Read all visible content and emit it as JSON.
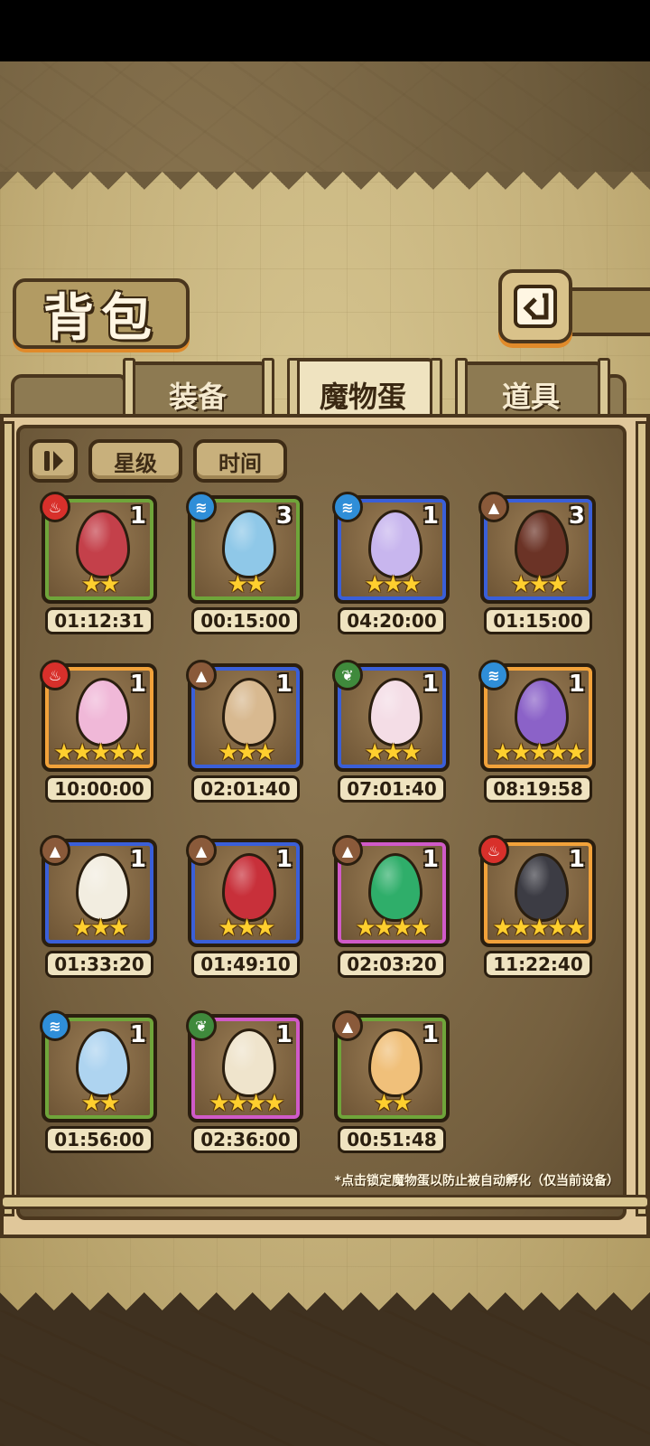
{
  "title": "背包",
  "tabs": [
    {
      "label": "装备",
      "active": false
    },
    {
      "label": "魔物蛋",
      "active": true
    },
    {
      "label": "道具",
      "active": false
    }
  ],
  "filters": {
    "toggle_icon": "pause-toggle-icon",
    "star": "星级",
    "time": "时间"
  },
  "footnote": "*点击锁定魔物蛋以防止被自动孵化（仅当前设备）",
  "element_colors": {
    "fire": "#d8302b",
    "water": "#2f8ed8",
    "earth": "#8a5a3a",
    "wood": "#3f8a3c"
  },
  "rarity_colors": {
    "green": "#6fa53a",
    "blue": "#3a5fd8",
    "gold": "#f2a23a",
    "purple": "#d05ac8"
  },
  "eggs": [
    {
      "element": "fire",
      "count": "1",
      "stars": 2,
      "rarity": "green",
      "timer": "01:12:31",
      "color": "#c4404a"
    },
    {
      "element": "water",
      "count": "3",
      "stars": 2,
      "rarity": "green",
      "timer": "00:15:00",
      "color": "#8fc8e8"
    },
    {
      "element": "water",
      "count": "1",
      "stars": 3,
      "rarity": "blue",
      "timer": "04:20:00",
      "color": "#c8b6ee"
    },
    {
      "element": "earth",
      "count": "3",
      "stars": 3,
      "rarity": "blue",
      "timer": "01:15:00",
      "color": "#6b3326"
    },
    {
      "element": "fire",
      "count": "1",
      "stars": 5,
      "rarity": "gold",
      "timer": "10:00:00",
      "color": "#f0b8d8"
    },
    {
      "element": "earth",
      "count": "1",
      "stars": 3,
      "rarity": "blue",
      "timer": "02:01:40",
      "color": "#d8b990"
    },
    {
      "element": "wood",
      "count": "1",
      "stars": 3,
      "rarity": "blue",
      "timer": "07:01:40",
      "color": "#f4dde6"
    },
    {
      "element": "water",
      "count": "1",
      "stars": 5,
      "rarity": "gold",
      "timer": "08:19:58",
      "color": "#8b62c8"
    },
    {
      "element": "earth",
      "count": "1",
      "stars": 3,
      "rarity": "blue",
      "timer": "01:33:20",
      "color": "#f2ede0"
    },
    {
      "element": "earth",
      "count": "1",
      "stars": 3,
      "rarity": "blue",
      "timer": "01:49:10",
      "color": "#c8303a"
    },
    {
      "element": "earth",
      "count": "1",
      "stars": 4,
      "rarity": "purple",
      "timer": "02:03:20",
      "color": "#2fae6a"
    },
    {
      "element": "fire",
      "count": "1",
      "stars": 5,
      "rarity": "gold",
      "timer": "11:22:40",
      "color": "#3c3c44"
    },
    {
      "element": "water",
      "count": "1",
      "stars": 2,
      "rarity": "green",
      "timer": "01:56:00",
      "color": "#aed4f0"
    },
    {
      "element": "wood",
      "count": "1",
      "stars": 4,
      "rarity": "purple",
      "timer": "02:36:00",
      "color": "#efe4cc"
    },
    {
      "element": "earth",
      "count": "1",
      "stars": 2,
      "rarity": "green",
      "timer": "00:51:48",
      "color": "#f0c07a"
    }
  ]
}
